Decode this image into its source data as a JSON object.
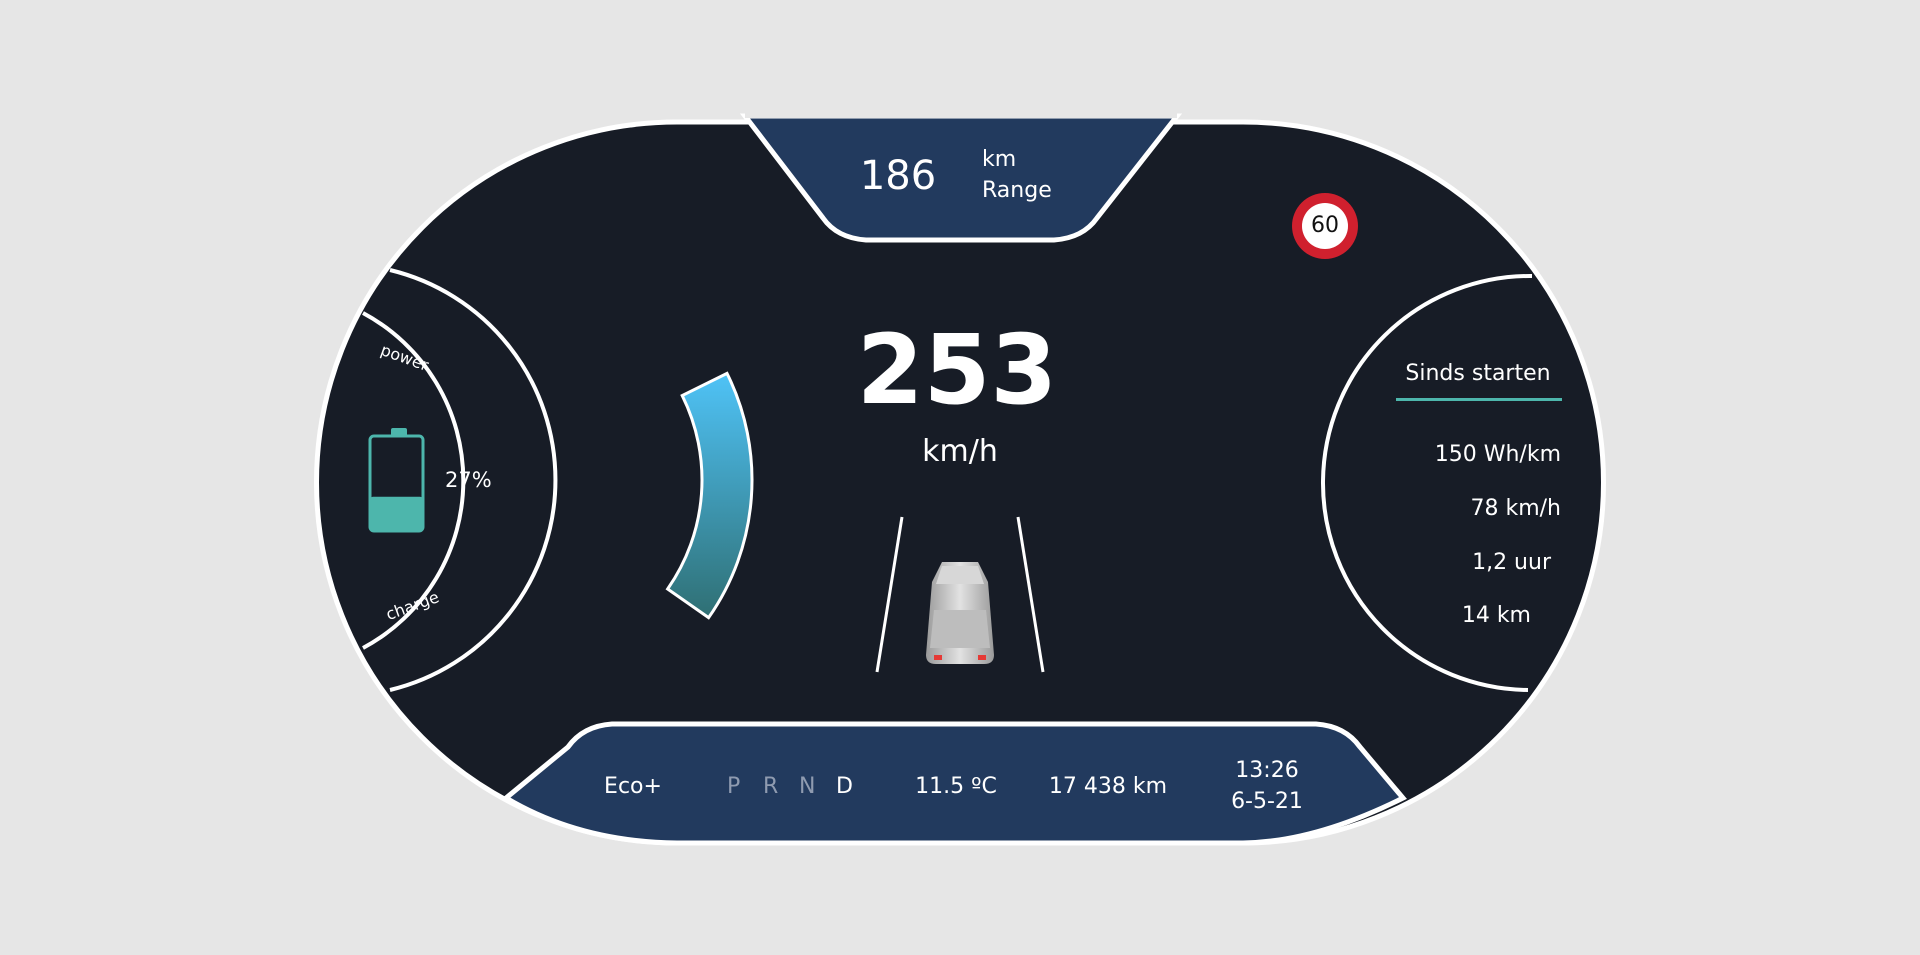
{
  "colors": {
    "background": "#e6e6e6",
    "panel": "#171c26",
    "outline": "#ffffff",
    "navy": "#223a5e",
    "accent_teal": "#4db6ac",
    "gauge_top": "#4fc3f7",
    "gauge_bottom": "#2f6f73",
    "speed_sign_ring": "#d0202e"
  },
  "range": {
    "value": "186",
    "unit": "km",
    "label": "Range"
  },
  "speed_limit": {
    "value": "60",
    "icon": "speed-limit-sign-icon"
  },
  "speed": {
    "value": "253",
    "unit": "km/h"
  },
  "power_gauge": {
    "top_label": "power",
    "bottom_label": "charge",
    "level_fraction": 0.62
  },
  "battery": {
    "percent_text": "27%",
    "level_fraction": 0.27,
    "icon": "battery-icon"
  },
  "trip": {
    "title": "Sinds starten",
    "stats": [
      "150 Wh/km",
      "78 km/h",
      "1,2 uur",
      "14 km"
    ]
  },
  "vehicle": {
    "icon": "car-icon"
  },
  "bottom_bar": {
    "mode": "Eco+",
    "gears": [
      "P",
      "R",
      "N",
      "D"
    ],
    "active_gear": "D",
    "temperature": "11.5 ºC",
    "odometer": "17 438 km",
    "time": "13:26",
    "date": "6-5-21"
  }
}
